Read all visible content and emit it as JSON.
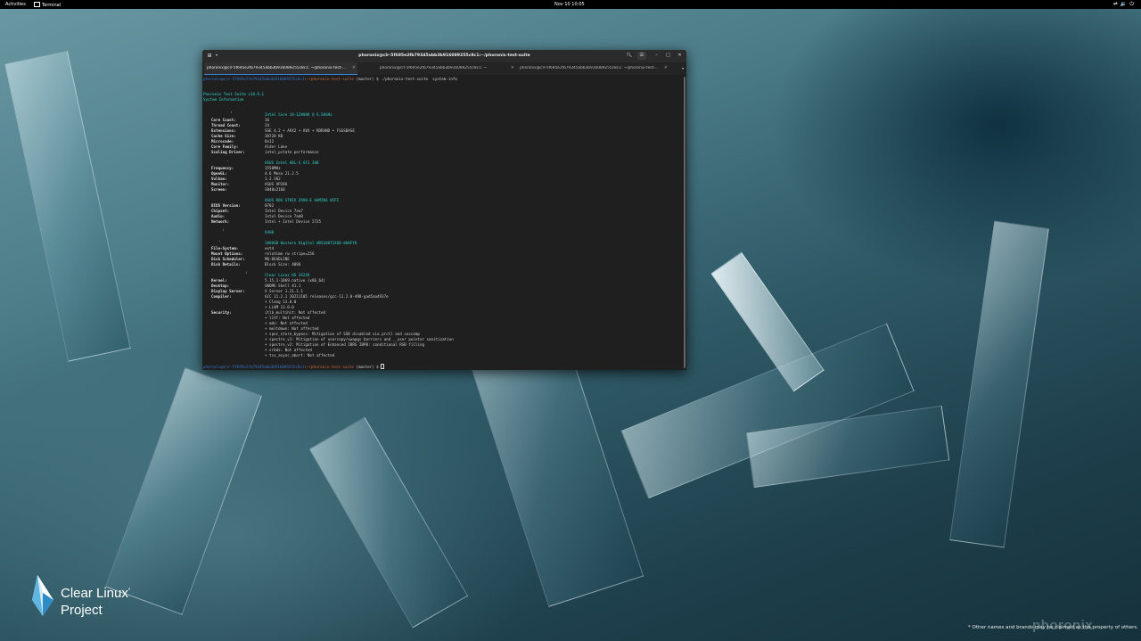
{
  "topbar": {
    "activities": "Activities",
    "app_name": "Terminal",
    "clock": "Nov 10  10:05",
    "tray_icons": [
      "network-icon",
      "volume-icon",
      "power-icon"
    ]
  },
  "window": {
    "title": "phoronix@clr-5f695e2fb79345abb3b916089255c8c1:~/phoronix-test-suite",
    "tabs": [
      {
        "label": "phoronix@clr-5f695e2fb79345abb3b916089255c8c1: ~/phoronix-test-...",
        "active": true
      },
      {
        "label": "phoronix@clr-5f695e2fb79345abb3b916089255c8c1: ~",
        "active": false
      },
      {
        "label": "phoronix@clr-5f695e2fb79345abb3b916089255c8c1: ~/phoronix-test-...",
        "active": false
      }
    ]
  },
  "terminal": {
    "prompt_user": "phoronix@clr-5f695e2fb79345abb3b916089255c8c1",
    "prompt_path": "~/phoronix-test-suite",
    "prompt_branch": " (master) $ ",
    "command": "./phoronix-test-suite  system-info",
    "suite_version": "Phoronix Test Suite v10.6.1",
    "system_info_title": "System Information",
    "processor": {
      "header": "Intel Core i9-12900K @ 6.50GHz",
      "rows": [
        {
          "k": "Core Count:",
          "v": "16"
        },
        {
          "k": "Thread Count:",
          "v": "24"
        },
        {
          "k": "Extensions:",
          "v": "SSE 4.2 + AVX2 + AVX + RDRAND + FSGSBASE"
        },
        {
          "k": "Cache Size:",
          "v": "30720 KB"
        },
        {
          "k": "Microcode:",
          "v": "0x12"
        },
        {
          "k": "Core Family:",
          "v": "Alder Lake"
        },
        {
          "k": "Scaling Driver:",
          "v": "intel_pstate performance"
        }
      ]
    },
    "graphics": {
      "header": "ASUS Intel ADL-S GT1 3GB",
      "rows": [
        {
          "k": "Frequency:",
          "v": "1550MHz"
        },
        {
          "k": "OpenGL:",
          "v": "4.6 Mesa 21.2.5"
        },
        {
          "k": "Vulkan:",
          "v": "1.2.182"
        },
        {
          "k": "Monitor:",
          "v": "ASUS VP28U"
        },
        {
          "k": "Screen:",
          "v": "3840x2160"
        }
      ]
    },
    "motherboard": {
      "header": "ASUS ROG STRIX Z690-E GAMING WIFI",
      "rows": [
        {
          "k": "BIOS Version:",
          "v": "0702"
        },
        {
          "k": "Chipset:",
          "v": "Intel Device 7aa7"
        },
        {
          "k": "Audio:",
          "v": "Intel Device 7ad0"
        },
        {
          "k": "Network:",
          "v": "Intel + Intel Device 2725"
        }
      ]
    },
    "memory": {
      "header": "64GB"
    },
    "disk": {
      "header": "1000GB Western Digital WDS100T1X0E-00AFY0",
      "rows": [
        {
          "k": "File-System:",
          "v": "ext4"
        },
        {
          "k": "Mount Options:",
          "v": "relatime rw stripe=256"
        },
        {
          "k": "Disk Scheduler:",
          "v": "MQ-DEADLINE"
        },
        {
          "k": "Disk Details:",
          "v": "Block Size: 4096"
        }
      ]
    },
    "software": {
      "header": "Clear Linux OS 35220",
      "rows": [
        {
          "k": "Kernel:",
          "v": "5.15.1-1069.native (x86_64)"
        },
        {
          "k": "Desktop:",
          "v": "GNOME Shell 41.1"
        },
        {
          "k": "Display Server:",
          "v": "X Server 1.21.1.1"
        },
        {
          "k": "Compiler:",
          "v": "GCC 11.2.1 20211105 releases/gcc-11.2.0-498-gad5aa4937e"
        }
      ],
      "compiler_extra": [
        "+ Clang 13.0.0",
        "+ LLVM 13.0.0"
      ]
    },
    "security": {
      "label": "Security:",
      "items": [
        "itlb_multihit: Not affected",
        "+ l1tf: Not affected",
        "+ mds: Not affected",
        "+ meltdown: Not affected",
        "+ spec_store_bypass: Mitigation of SSB disabled via prctl and seccomp",
        "+ spectre_v1: Mitigation of usercopy/swapgs barriers and __user pointer sanitization",
        "+ spectre_v2: Mitigation of Enhanced IBRS IBPB: conditional RSB filling",
        "+ srbds: Not affected",
        "+ tsx_async_abort: Not affected"
      ]
    }
  },
  "logo": {
    "line1": "Clear Linux",
    "trademark": "*",
    "line2": "Project"
  },
  "disclaimer": "* Other names and brands may be claimed as the property of others.",
  "watermark": "phoronix"
}
